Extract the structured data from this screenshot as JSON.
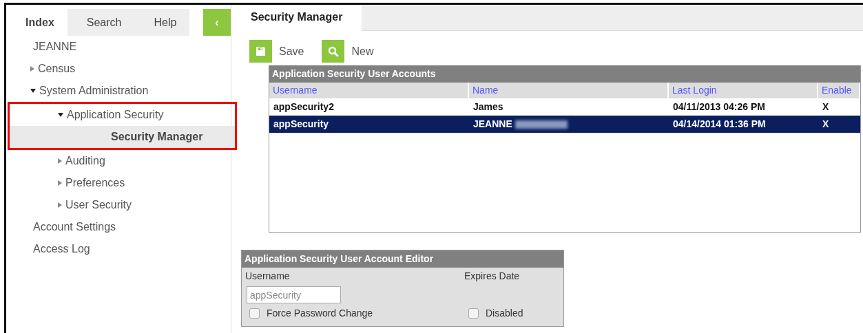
{
  "sidebar": {
    "tabs": [
      {
        "label": "Index",
        "selected": true
      },
      {
        "label": "Search",
        "selected": false
      },
      {
        "label": "Help",
        "selected": false
      }
    ],
    "collapse_button": {
      "label": "‹"
    },
    "tree": [
      {
        "label": "JEANNE",
        "kind": "leaf",
        "selected": false
      },
      {
        "label": "Census",
        "kind": "branch",
        "expanded": false,
        "selected": false
      },
      {
        "label": "System Administration",
        "kind": "branch",
        "expanded": true,
        "selected": false,
        "children": [
          {
            "label": "Application Security",
            "kind": "branch",
            "expanded": true,
            "selected": false,
            "highlighted": true,
            "children": [
              {
                "label": "Security Manager",
                "kind": "leaf",
                "selected": true
              }
            ]
          },
          {
            "label": "Auditing",
            "kind": "branch",
            "expanded": false,
            "selected": false
          },
          {
            "label": "Preferences",
            "kind": "branch",
            "expanded": false,
            "selected": false
          },
          {
            "label": "User Security",
            "kind": "branch",
            "expanded": false,
            "selected": false
          }
        ]
      },
      {
        "label": "Account Settings",
        "kind": "leaf",
        "selected": false
      },
      {
        "label": "Access Log",
        "kind": "leaf",
        "selected": false
      }
    ]
  },
  "main": {
    "tab": {
      "label": "Security Manager",
      "selected": true
    },
    "toolbar": [
      {
        "kind": "save",
        "label": "Save"
      },
      {
        "kind": "search",
        "label": "New"
      }
    ],
    "table": {
      "title": "Application Security User Accounts",
      "columns": [
        "Username",
        "Name",
        "Last Login",
        "Enable"
      ],
      "rows": [
        {
          "cells": [
            "appSecurity2",
            "James",
            "04/11/2013 04:26 PM",
            "X"
          ],
          "redacted": false,
          "selected": false
        },
        {
          "cells": [
            "appSecurity",
            "JEANNE",
            "04/14/2014 01:36 PM",
            "X"
          ],
          "redacted": true,
          "selected": true
        }
      ]
    },
    "editor": {
      "title": "Application Security User Account Editor",
      "username_label": "Username",
      "username_value": "appSecurity",
      "expires_label": "Expires Date",
      "checkboxes": [
        {
          "label": "Force Password Change",
          "checked": false
        },
        {
          "label": "Disabled",
          "checked": false
        }
      ]
    }
  }
}
